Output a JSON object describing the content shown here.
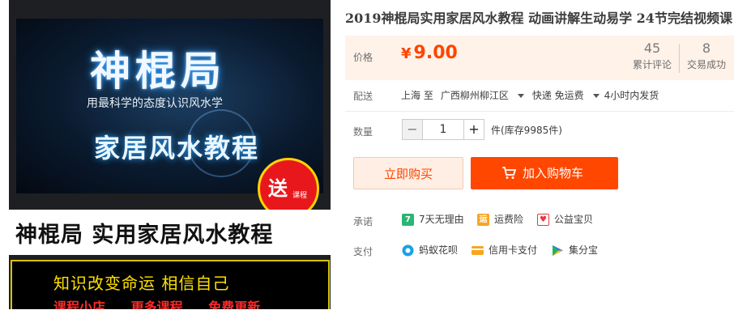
{
  "image": {
    "logo_text": "神棍局",
    "slogan": "用最科学的态度认识风水学",
    "sub_logo": "家居风水教程",
    "gift_big": "送",
    "gift_small": "课程",
    "title": "神棍局  实用家居风水教程",
    "line1": "知识改变命运    相信自己",
    "line2": [
      "课程小店",
      "更多课程",
      "免费更新"
    ]
  },
  "product": {
    "title": "2019神棍局实用家居风水教程 动画讲解生动易学 24节完结视频课"
  },
  "price": {
    "label": "价格",
    "currency": "¥",
    "value": "9.00",
    "color": "#ff4400"
  },
  "stats": {
    "reviews_count": "45",
    "reviews_label": "累计评论",
    "deals_count": "8",
    "deals_label": "交易成功"
  },
  "shipping": {
    "label": "配送",
    "from": "上海 至",
    "to": "广西柳州柳江区",
    "method": "快递 免运费",
    "dispatch": "4小时内发货"
  },
  "quantity": {
    "label": "数量",
    "minus": "−",
    "plus": "+",
    "value": "1",
    "unit_stock": "件(库存9985件)"
  },
  "actions": {
    "buy_now": "立即购买",
    "add_to_cart": "加入购物车",
    "accent": "#ff4700"
  },
  "promise": {
    "label": "承诺",
    "items": [
      {
        "icon": "seven-day-icon",
        "glyph": "7",
        "text": "7天无理由"
      },
      {
        "icon": "shipping-insurance-icon",
        "glyph": "运",
        "text": "运费险"
      },
      {
        "icon": "charity-icon",
        "glyph": "♥",
        "text": "公益宝贝"
      }
    ]
  },
  "payment": {
    "label": "支付",
    "items": [
      {
        "icon": "huabei-icon",
        "text": "蚂蚁花呗"
      },
      {
        "icon": "credit-card-icon",
        "text": "信用卡支付"
      },
      {
        "icon": "jifenbao-icon",
        "text": "集分宝"
      }
    ]
  }
}
